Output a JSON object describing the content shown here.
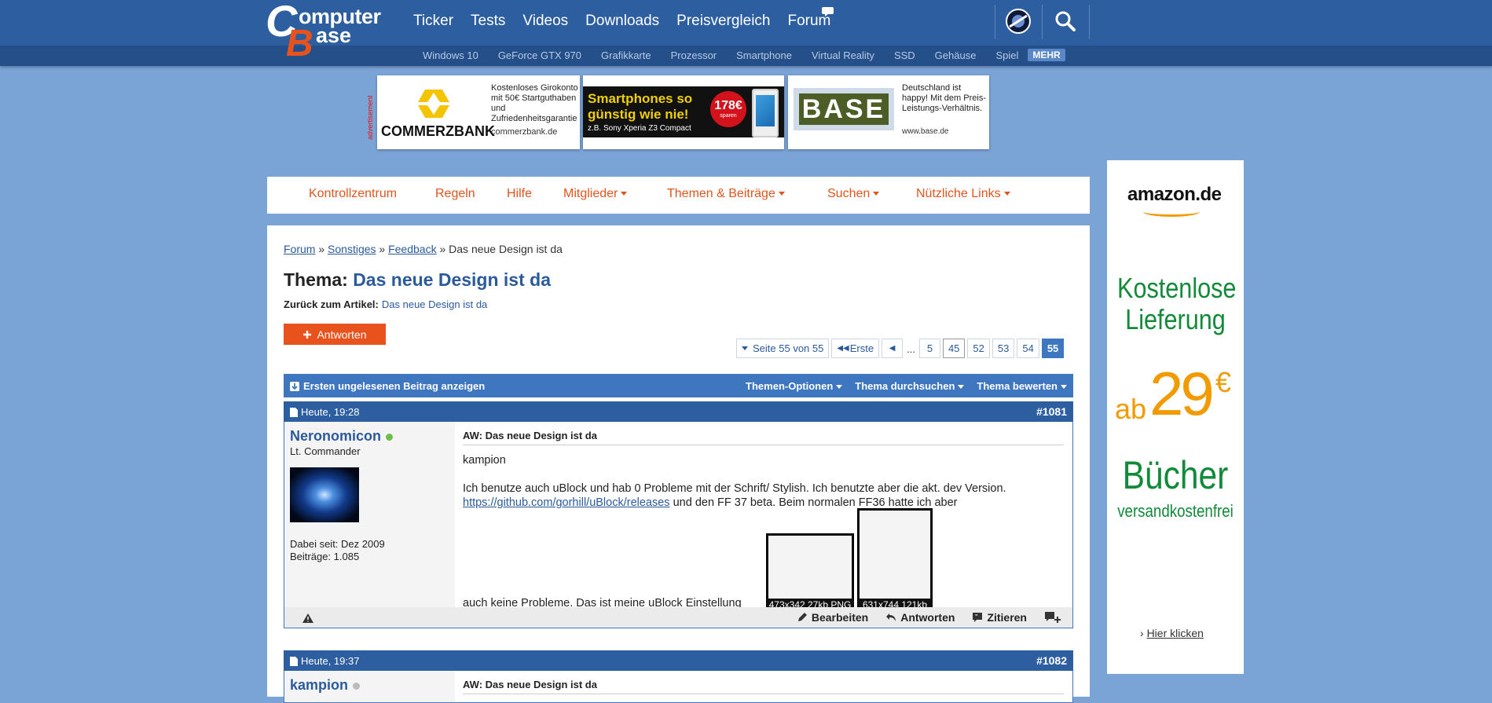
{
  "header": {
    "logo": {
      "line1": "Computer",
      "line2": "Base"
    },
    "nav": [
      "Ticker",
      "Tests",
      "Videos",
      "Downloads",
      "Preisvergleich",
      "Forum"
    ],
    "tags": [
      "Windows 10",
      "GeForce GTX 970",
      "Grafikkarte",
      "Prozessor",
      "Smartphone",
      "Virtual Reality",
      "SSD",
      "Gehäuse",
      "Spiel"
    ],
    "more_label": "MEHR",
    "icons": [
      "theme-toggle-icon",
      "search-icon"
    ]
  },
  "ads": {
    "label": "advertisement",
    "commerzbank": {
      "brand": "COMMERZBANK",
      "text": "Kostenloses Girokonto mit 50€ Startguthaben und Zufriedenheitsgarantie",
      "url": "commerzbank.de"
    },
    "smartphone": {
      "headline1": "Smartphones so",
      "headline2": "günstig wie nie!",
      "sub": "z.B. Sony Xperia Z3 Compact",
      "price": "178€",
      "price_sub": "sparen"
    },
    "base": {
      "brand": "BASE",
      "text": "Deutschland ist happy! Mit dem Preis-Leistungs-Verhältnis.",
      "url": "www.base.de"
    },
    "right": {
      "brand": "amazon.de",
      "line1": "Kostenlose",
      "line2": "Lieferung",
      "ab": "ab",
      "price": "29",
      "currency": "€",
      "books": "Bücher",
      "books_sub": "versandkostenfrei",
      "cta": "Hier klicken"
    }
  },
  "forum_nav": [
    {
      "label": "Kontrollzentrum",
      "dropdown": false
    },
    {
      "label": "Regeln",
      "dropdown": false
    },
    {
      "label": "Hilfe",
      "dropdown": false
    },
    {
      "label": "Mitglieder",
      "dropdown": true
    },
    {
      "label": "Themen & Beiträge",
      "dropdown": true
    },
    {
      "label": "Suchen",
      "dropdown": true
    },
    {
      "label": "Nützliche Links",
      "dropdown": true
    }
  ],
  "breadcrumb": {
    "items": [
      "Forum",
      "Sonstiges",
      "Feedback"
    ],
    "current": "Das neue Design ist da",
    "sep": "»"
  },
  "thread": {
    "prefix": "Thema:",
    "title": "Das neue Design ist da",
    "back_label": "Zurück zum Artikel:",
    "back_link": "Das neue Design ist da",
    "reply_label": "Antworten"
  },
  "pager": {
    "label": "Seite 55 von 55",
    "first": "Erste",
    "pages": [
      "5",
      "45",
      "52",
      "53",
      "54",
      "55"
    ],
    "current": "55",
    "ellipsis": "..."
  },
  "toolbar": {
    "unread": "Ersten ungelesenen Beitrag anzeigen",
    "options": [
      "Themen-Optionen",
      "Thema durchsuchen",
      "Thema bewerten"
    ]
  },
  "posts": [
    {
      "date": "Heute, 19:28",
      "number": "#1081",
      "author": "Neronomicon",
      "online": true,
      "rank": "Lt. Commander",
      "joined": "Dabei seit: Dez 2009",
      "posts": "Beiträge: 1.085",
      "title": "AW: Das neue Design ist da",
      "quote_name": "kampion",
      "body_1": "Ich benutze auch uBlock und hab 0 Probleme mit der Schrift/ Stylish. Ich benutzte aber die akt. dev Version.",
      "link": "https://github.com/gorhill/uBlock/releases",
      "body_2": "und den FF 37 beta. Beim normalen FF36 hatte ich aber",
      "body_3": "auch keine Probleme. Das ist meine uBlock Einstellung",
      "attachments": [
        "473x342 27kb PNG",
        "631x744 121kb"
      ],
      "actions": [
        "Bearbeiten",
        "Antworten",
        "Zitieren"
      ]
    },
    {
      "date": "Heute, 19:37",
      "number": "#1082",
      "author": "kampion",
      "online": false,
      "title": "AW: Das neue Design ist da"
    }
  ]
}
